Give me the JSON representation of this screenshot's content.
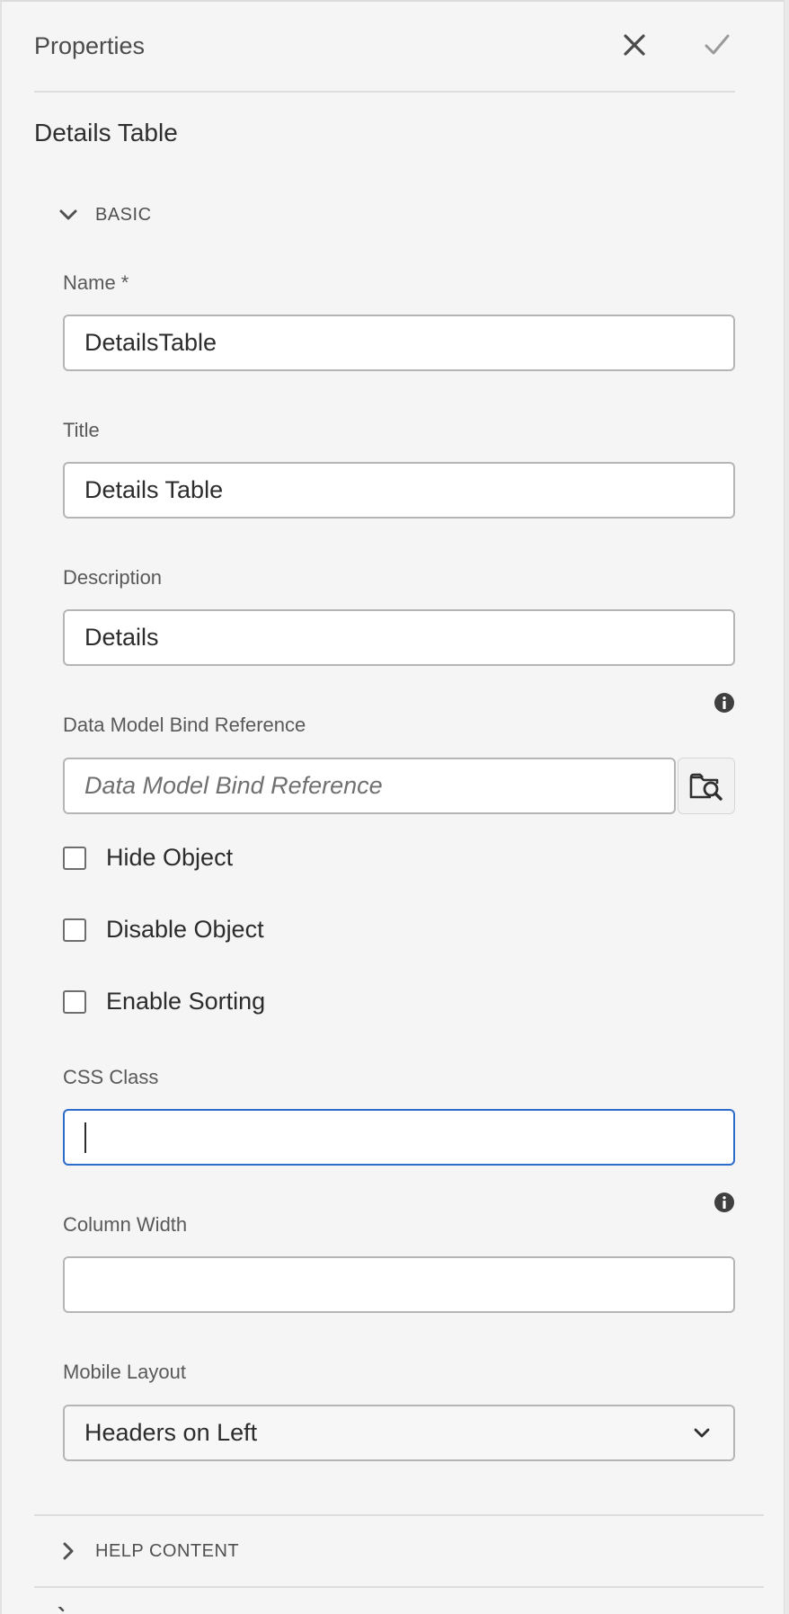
{
  "panel": {
    "title": "Properties",
    "close_icon": "close-icon",
    "confirm_icon": "checkmark-icon",
    "component_name": "Details Table"
  },
  "basic": {
    "section_label": "BASIC",
    "expanded": true,
    "name": {
      "label": "Name *",
      "value": "DetailsTable"
    },
    "title": {
      "label": "Title",
      "value": "Details Table"
    },
    "description": {
      "label": "Description",
      "value": "Details"
    },
    "bind_reference": {
      "label": "Data Model Bind Reference",
      "value": "",
      "placeholder": "Data Model Bind Reference",
      "browse_icon": "folder-search-icon",
      "info_icon": "info-icon"
    },
    "hide_object": {
      "label": "Hide Object",
      "checked": false
    },
    "disable_object": {
      "label": "Disable Object",
      "checked": false
    },
    "enable_sorting": {
      "label": "Enable Sorting",
      "checked": false
    },
    "css_class": {
      "label": "CSS Class",
      "value": "",
      "focused": true
    },
    "column_width": {
      "label": "Column Width",
      "value": "",
      "info_icon": "info-icon"
    },
    "mobile_layout": {
      "label": "Mobile Layout",
      "selected": "Headers on Left"
    }
  },
  "help_content": {
    "section_label": "HELP CONTENT",
    "expanded": false
  },
  "colors": {
    "focus_border": "#2d6cc9",
    "input_border": "#b5b5b5",
    "panel_bg": "#f5f5f5"
  }
}
